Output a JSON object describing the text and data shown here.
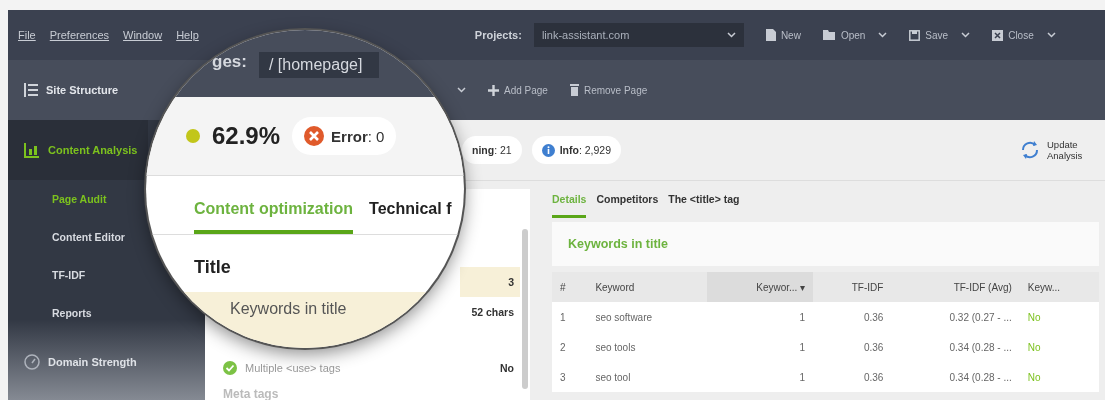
{
  "menu": [
    "File",
    "Preferences",
    "Window",
    "Help"
  ],
  "projects": {
    "label": "Projects:",
    "value": "link-assistant.com"
  },
  "toolbar": [
    {
      "label": "New",
      "kind": "document",
      "dropdown": false
    },
    {
      "label": "Open",
      "kind": "folder",
      "dropdown": true
    },
    {
      "label": "Save",
      "kind": "save",
      "dropdown": true
    },
    {
      "label": "Close",
      "kind": "close",
      "dropdown": true
    }
  ],
  "sidebar": {
    "header": "Site Structure",
    "items": [
      {
        "label": "Content Analysis",
        "kind": "chart",
        "selected": true,
        "children": [
          {
            "label": "Page Audit",
            "selected": true
          },
          {
            "label": "Content Editor",
            "selected": false
          },
          {
            "label": "TF-IDF",
            "selected": false
          },
          {
            "label": "Reports",
            "selected": false
          }
        ]
      },
      {
        "label": "Domain Strength",
        "kind": "gauge",
        "selected": false
      }
    ]
  },
  "page_actions": [
    {
      "label": "Add Page",
      "kind": "add"
    },
    {
      "label": "Remove Page",
      "kind": "trash"
    }
  ],
  "magnifier": {
    "pages_label": "ges:",
    "page": "/ [homepage]",
    "score": "62.9%",
    "error": "**Error**: 0",
    "tabs": [
      {
        "label": "Content optimization",
        "selected": true
      },
      {
        "label": "Technical f",
        "selected": false
      }
    ],
    "section": "Title",
    "row": "Keywords in title"
  },
  "summary": {
    "warning": "**ning**: 21",
    "info": "**Info**: 2,929",
    "update": "Update Analysis"
  },
  "issues": [
    {
      "kind": "value",
      "value": "3",
      "highlight": true
    },
    {
      "kind": "value",
      "value": "52 chars",
      "highlight": false
    },
    {
      "kind": "check",
      "label": "Multiple <use> tags",
      "value": "No",
      "highlight": false
    },
    {
      "kind": "section",
      "label": "Meta tags"
    }
  ],
  "detail_tabs": [
    {
      "label": "Details",
      "selected": true
    },
    {
      "label": "Competitors",
      "selected": false
    },
    {
      "label": "The <title> tag",
      "selected": false
    }
  ],
  "card_title": "Keywords in title",
  "table": {
    "columns": [
      "#",
      "Keyword",
      "Keywor... ▾",
      "TF-IDF",
      "TF-IDF (Avg)",
      "Keyw..."
    ],
    "rows": [
      [
        "1",
        "seo software",
        "1",
        "0.36",
        "0.32 (0.27 - ...",
        "No"
      ],
      [
        "2",
        "seo tools",
        "1",
        "0.36",
        "0.34 (0.28 - ...",
        "No"
      ],
      [
        "3",
        "seo tool",
        "1",
        "0.36",
        "0.34 (0.28 - ...",
        "No"
      ]
    ]
  }
}
